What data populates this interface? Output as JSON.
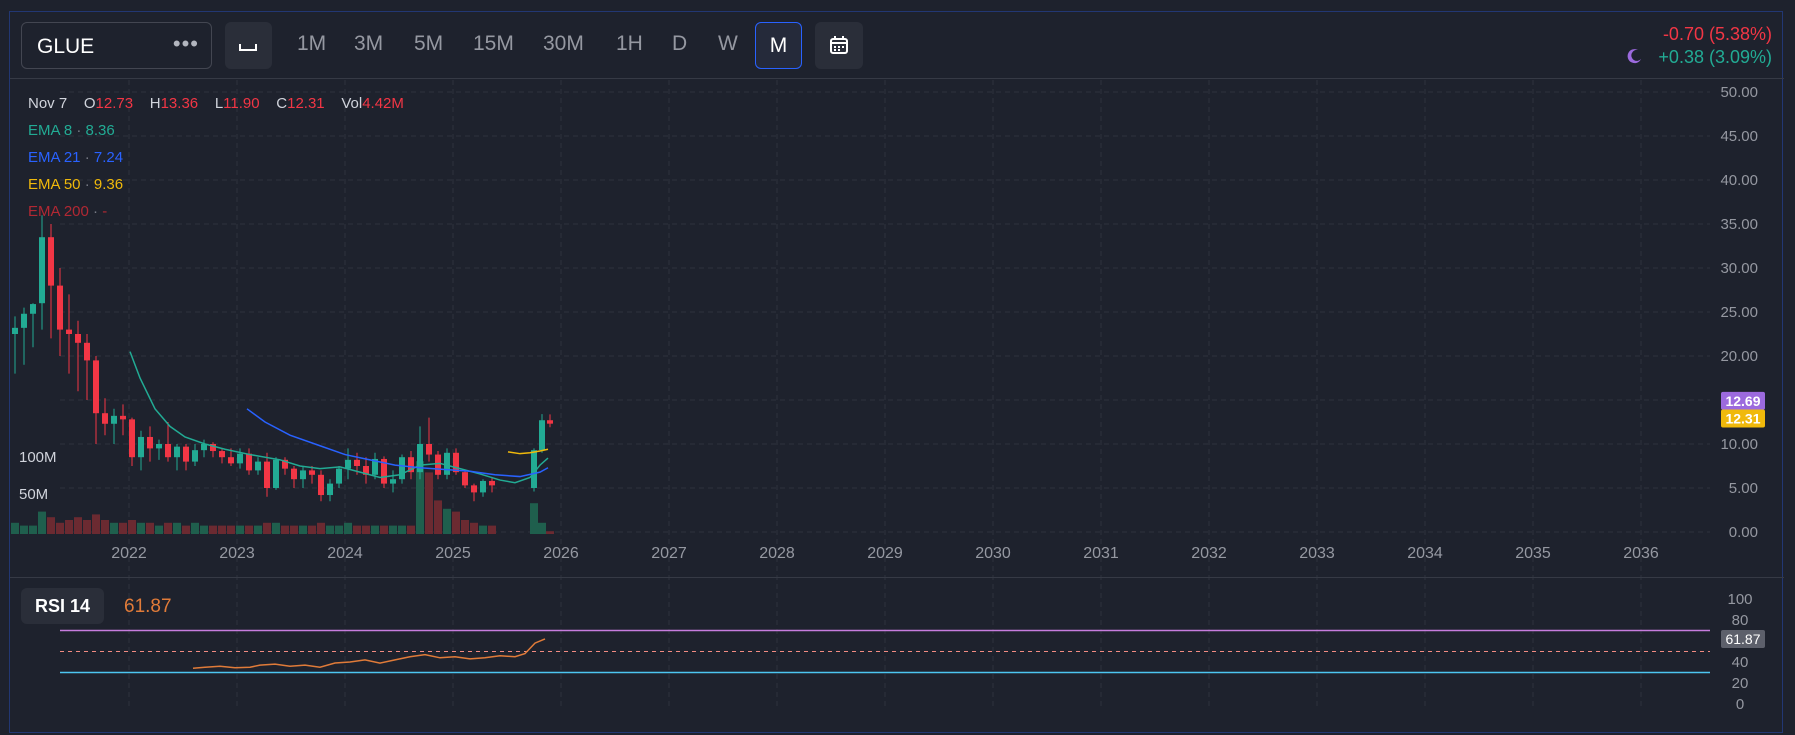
{
  "toolbar": {
    "symbol": "GLUE",
    "more": "•••",
    "timeframes": [
      "1M",
      "3M",
      "5M",
      "15M",
      "30M",
      "1H",
      "D",
      "W"
    ],
    "active_timeframe": "M",
    "change_down": "-0.70 (5.38%)",
    "change_up": "+0.38 (3.09%)"
  },
  "legend": {
    "date": "Nov 7",
    "o_label": "O",
    "o_value": "12.73",
    "h_label": "H",
    "h_value": "13.36",
    "l_label": "L",
    "l_value": "11.90",
    "c_label": "C",
    "c_value": "12.31",
    "vol_label": "Vol",
    "vol_value": "4.42M",
    "ema8_label": "EMA 8",
    "ema8_value": "8.36",
    "ema21_label": "EMA 21",
    "ema21_value": "7.24",
    "ema50_label": "EMA 50",
    "ema50_value": "9.36",
    "ema200_label": "EMA 200",
    "ema200_value": "-"
  },
  "volume_labels": [
    "100M",
    "50M"
  ],
  "price_axis": [
    "50.00",
    "45.00",
    "40.00",
    "35.00",
    "30.00",
    "25.00",
    "20.00",
    "15.00",
    "10.00",
    "5.00",
    "0.00"
  ],
  "price_tags": {
    "last": "12.69",
    "close": "12.31"
  },
  "time_axis": [
    "2022",
    "2023",
    "2024",
    "2025",
    "2026",
    "2027",
    "2028",
    "2029",
    "2030",
    "2031",
    "2032",
    "2033",
    "2034",
    "2035",
    "2036"
  ],
  "rsi": {
    "label": "RSI 14",
    "value": "61.87",
    "axis": [
      "100",
      "80",
      "60",
      "40",
      "20",
      "0"
    ],
    "tag": "61.87"
  },
  "colors": {
    "up": "#22ab94",
    "down": "#f23645",
    "ema8": "#22ab94",
    "ema21": "#2962ff",
    "ema50": "#f0b90b",
    "ema200": "#f23645",
    "rsi": "#e07b39",
    "badge_purple": "#9c6ade",
    "badge_yellow": "#f0b90b"
  }
}
